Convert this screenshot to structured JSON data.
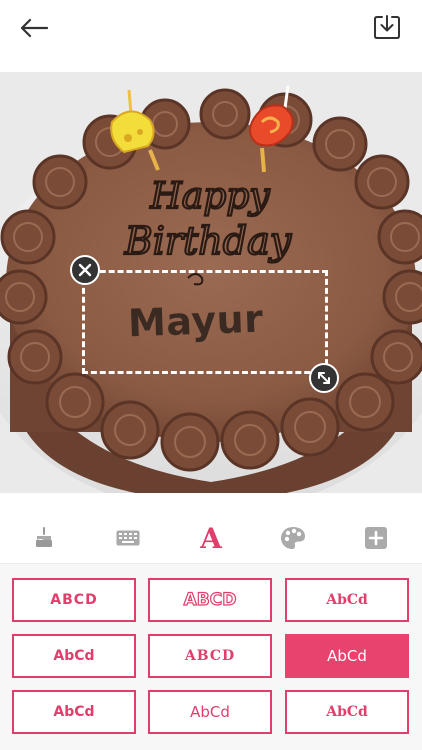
{
  "header": {
    "back_icon": "arrow-left-icon",
    "save_icon": "download-tray-icon"
  },
  "photo": {
    "cake_text_line1": "Happy",
    "cake_text_line2": "Birthday",
    "sticker_text": "Mayur"
  },
  "toolbar": {
    "items": [
      {
        "icon": "cake-icon",
        "active": false
      },
      {
        "icon": "keyboard-icon",
        "active": false
      },
      {
        "icon": "font-a-icon",
        "label": "A",
        "active": true
      },
      {
        "icon": "palette-icon",
        "active": false
      },
      {
        "icon": "plus-square-icon",
        "active": false
      }
    ],
    "accent": "#e23d6b"
  },
  "font_styles": [
    {
      "label": "ABCD"
    },
    {
      "label": "ABCD"
    },
    {
      "label": "AbCd"
    },
    {
      "label": "AbCd"
    },
    {
      "label": "ABCD"
    },
    {
      "label": "AbCd",
      "selected": true
    },
    {
      "label": "AbCd"
    },
    {
      "label": "AbCd"
    },
    {
      "label": "AbCd"
    }
  ]
}
